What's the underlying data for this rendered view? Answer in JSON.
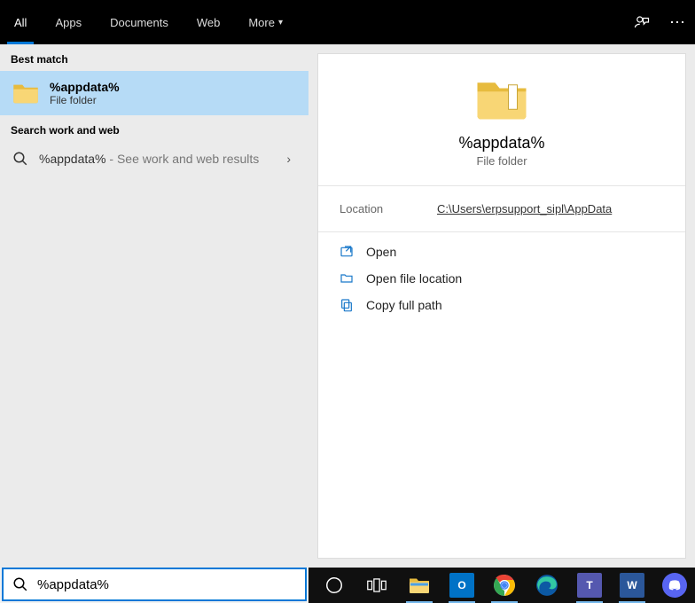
{
  "tabs": {
    "all": "All",
    "apps": "Apps",
    "documents": "Documents",
    "web": "Web",
    "more": "More"
  },
  "sections": {
    "best_match": "Best match",
    "work_and_web": "Search work and web"
  },
  "best_match": {
    "title": "%appdata%",
    "subtitle": "File folder"
  },
  "web_result": {
    "term": "%appdata%",
    "suffix": " - See work and web results"
  },
  "preview": {
    "title": "%appdata%",
    "subtitle": "File folder",
    "location_label": "Location",
    "location_value": "C:\\Users\\erpsupport_sipl\\AppData"
  },
  "actions": {
    "open": "Open",
    "open_location": "Open file location",
    "copy_path": "Copy full path"
  },
  "search": {
    "value": "%appdata%"
  }
}
